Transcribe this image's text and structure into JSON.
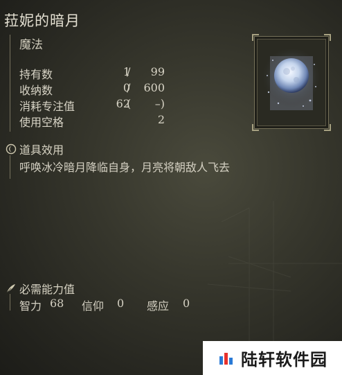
{
  "item": {
    "name": "菈妮的暗月",
    "category": "魔法",
    "stats": [
      {
        "label": "持有数",
        "value": "1",
        "sep": "/",
        "value2": "99"
      },
      {
        "label": "收纳数",
        "value": "0",
        "sep": "/",
        "value2": "600"
      },
      {
        "label": "消耗专注值",
        "value": "62",
        "sep": "(",
        "value2": "–)"
      },
      {
        "label": "使用空格",
        "value": "",
        "sep": "",
        "value2": "2"
      }
    ]
  },
  "effect": {
    "heading": "道具效用",
    "text": "呼唤冰冷暗月降临自身，月亮将朝敌人飞去"
  },
  "requirements": {
    "heading": "必需能力值",
    "items": [
      {
        "label": "智力",
        "value": "68"
      },
      {
        "label": "信仰",
        "value": "0"
      },
      {
        "label": "感应",
        "value": "0"
      }
    ]
  },
  "watermark": {
    "text": "陆轩软件园"
  },
  "colors": {
    "text": "#d8d4c4",
    "accent": "#a8a282",
    "background": "#36362c"
  }
}
